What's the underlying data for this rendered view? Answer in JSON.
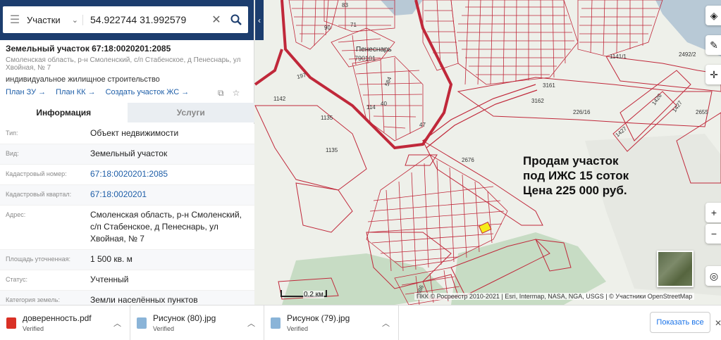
{
  "search": {
    "layer": "Участки",
    "coordinates": "54.922744 31.992579"
  },
  "parcel": {
    "title": "Земельный участок 67:18:0020201:2085",
    "address_small": "Смоленская область, р-н Смоленский, с/п Стабенское, д Пенеснарь, ул Хвойная, № 7",
    "use": "индивидуальное жилищное строительство",
    "links": [
      "План ЗУ →",
      "План КК →",
      "Создать участок ЖС →"
    ]
  },
  "tabs": [
    {
      "label": "Информация",
      "active": true
    },
    {
      "label": "Услуги",
      "active": false
    }
  ],
  "properties": [
    {
      "key": "Тип:",
      "value": "Объект недвижимости"
    },
    {
      "key": "Вид:",
      "value": "Земельный участок"
    },
    {
      "key": "Кадастровый номер:",
      "value": "67:18:0020201:2085",
      "link": true
    },
    {
      "key": "Кадастровый квартал:",
      "value": "67:18:0020201",
      "link": true
    },
    {
      "key": "Адрес:",
      "value": "Смоленская область, р-н Смоленский, с/п Стабенское, д Пенеснарь, ул Хвойная, № 7"
    },
    {
      "key": "Площадь уточненная:",
      "value": "1 500 кв. м"
    },
    {
      "key": "Статус:",
      "value": "Учтенный"
    },
    {
      "key": "Категория земель:",
      "value": "Земли населённых пунктов"
    }
  ],
  "map": {
    "ad_lines": [
      "Продам участок",
      "под ИЖС 15 соток",
      "Цена 225 000 руб."
    ],
    "village_label": "Пенеснарь",
    "village_code": "790101",
    "parcel_labels": [
      "1142",
      "1135",
      "1135",
      "3161",
      "3162",
      "226/16",
      "1141/1",
      "2492/2",
      "1426",
      "1427",
      "1427",
      "2655",
      "2676",
      "197",
      "114",
      "40",
      "584",
      "47",
      "83",
      "90",
      "71",
      "2086"
    ],
    "scale_label": "0.2 км",
    "attribution": "ПКК © Росреестр 2010-2021 | Esri, Intermap, NASA, NGA, USGS | © Участники OpenStreetMap"
  },
  "downloads": {
    "items": [
      {
        "name": "доверенность.pdf",
        "status": "Verified",
        "type": "pdf"
      },
      {
        "name": "Рисунок (80).jpg",
        "status": "Verified",
        "type": "jpg"
      },
      {
        "name": "Рисунок (79).jpg",
        "status": "Verified",
        "type": "jpg"
      }
    ],
    "show_all": "Показать все"
  },
  "colors": {
    "header": "#1c3d6e",
    "parcel_line": "#c0283a",
    "link": "#1e5ea8"
  }
}
